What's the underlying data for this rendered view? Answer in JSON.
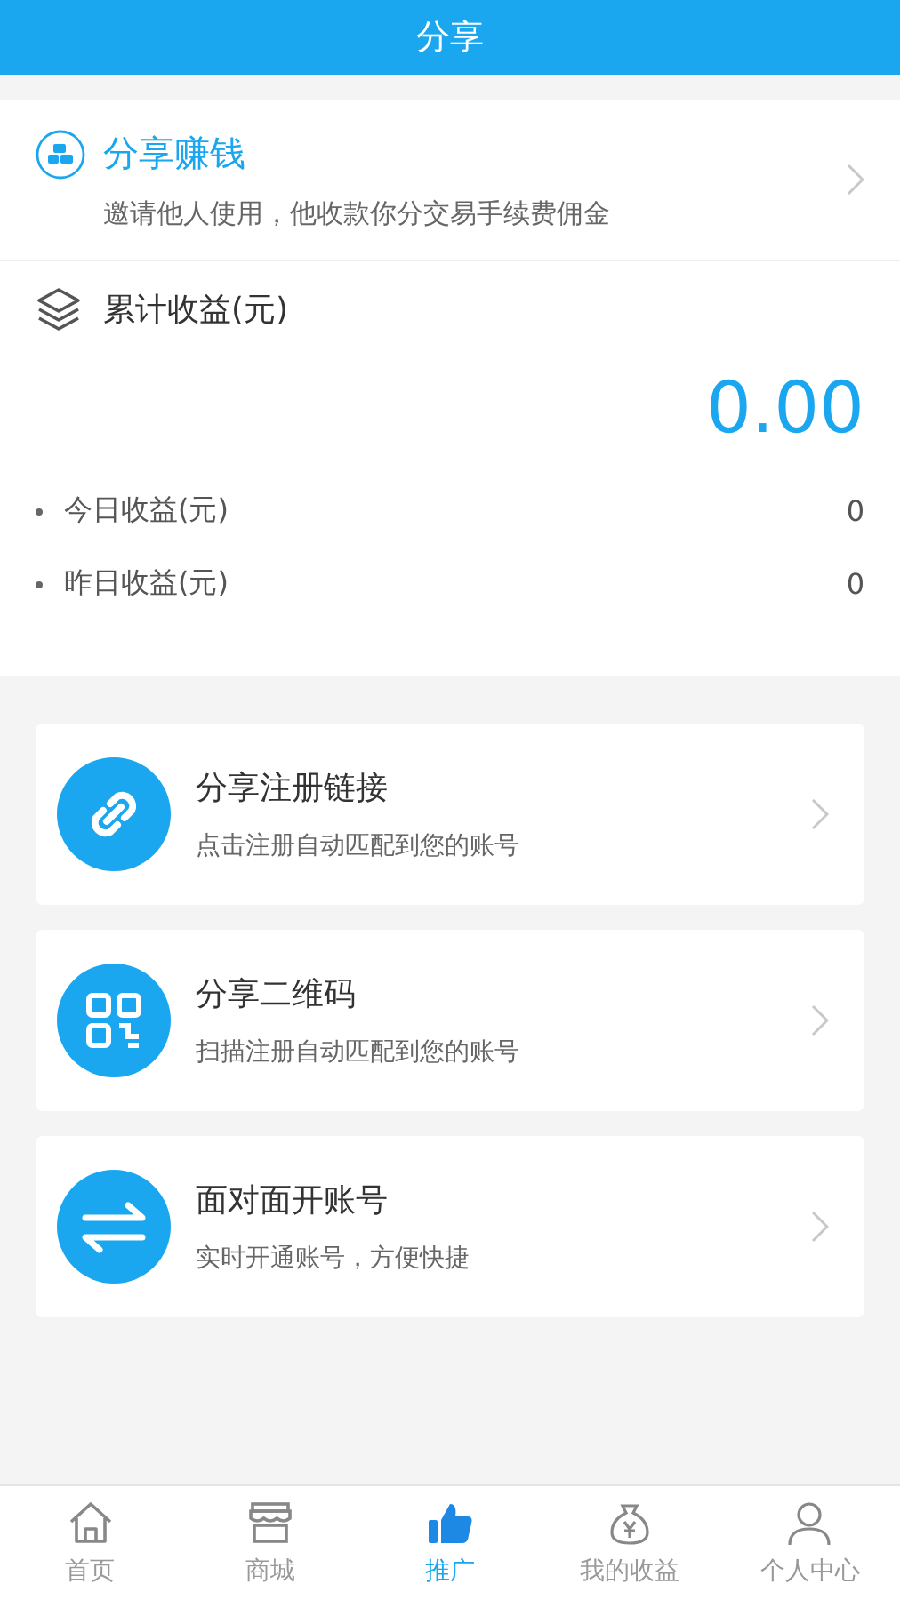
{
  "header": {
    "title": "分享"
  },
  "promo": {
    "title": "分享赚钱",
    "subtitle": "邀请他人使用，他收款你分交易手续费佣金"
  },
  "earnings": {
    "label": "累计收益(元)",
    "total": "0.00",
    "rows": [
      {
        "label": "今日收益(元)",
        "value": "0"
      },
      {
        "label": "昨日收益(元)",
        "value": "0"
      }
    ]
  },
  "actions": [
    {
      "kind": "link",
      "title": "分享注册链接",
      "subtitle": "点击注册自动匹配到您的账号"
    },
    {
      "kind": "qr",
      "title": "分享二维码",
      "subtitle": "扫描注册自动匹配到您的账号"
    },
    {
      "kind": "swap",
      "title": "面对面开账号",
      "subtitle": "实时开通账号，方便快捷"
    }
  ],
  "tabs": [
    {
      "kind": "home",
      "label": "首页",
      "selected": false
    },
    {
      "kind": "shop",
      "label": "商城",
      "selected": false
    },
    {
      "kind": "thumb",
      "label": "推广",
      "selected": true
    },
    {
      "kind": "money",
      "label": "我的收益",
      "selected": false
    },
    {
      "kind": "person",
      "label": "个人中心",
      "selected": false
    }
  ]
}
